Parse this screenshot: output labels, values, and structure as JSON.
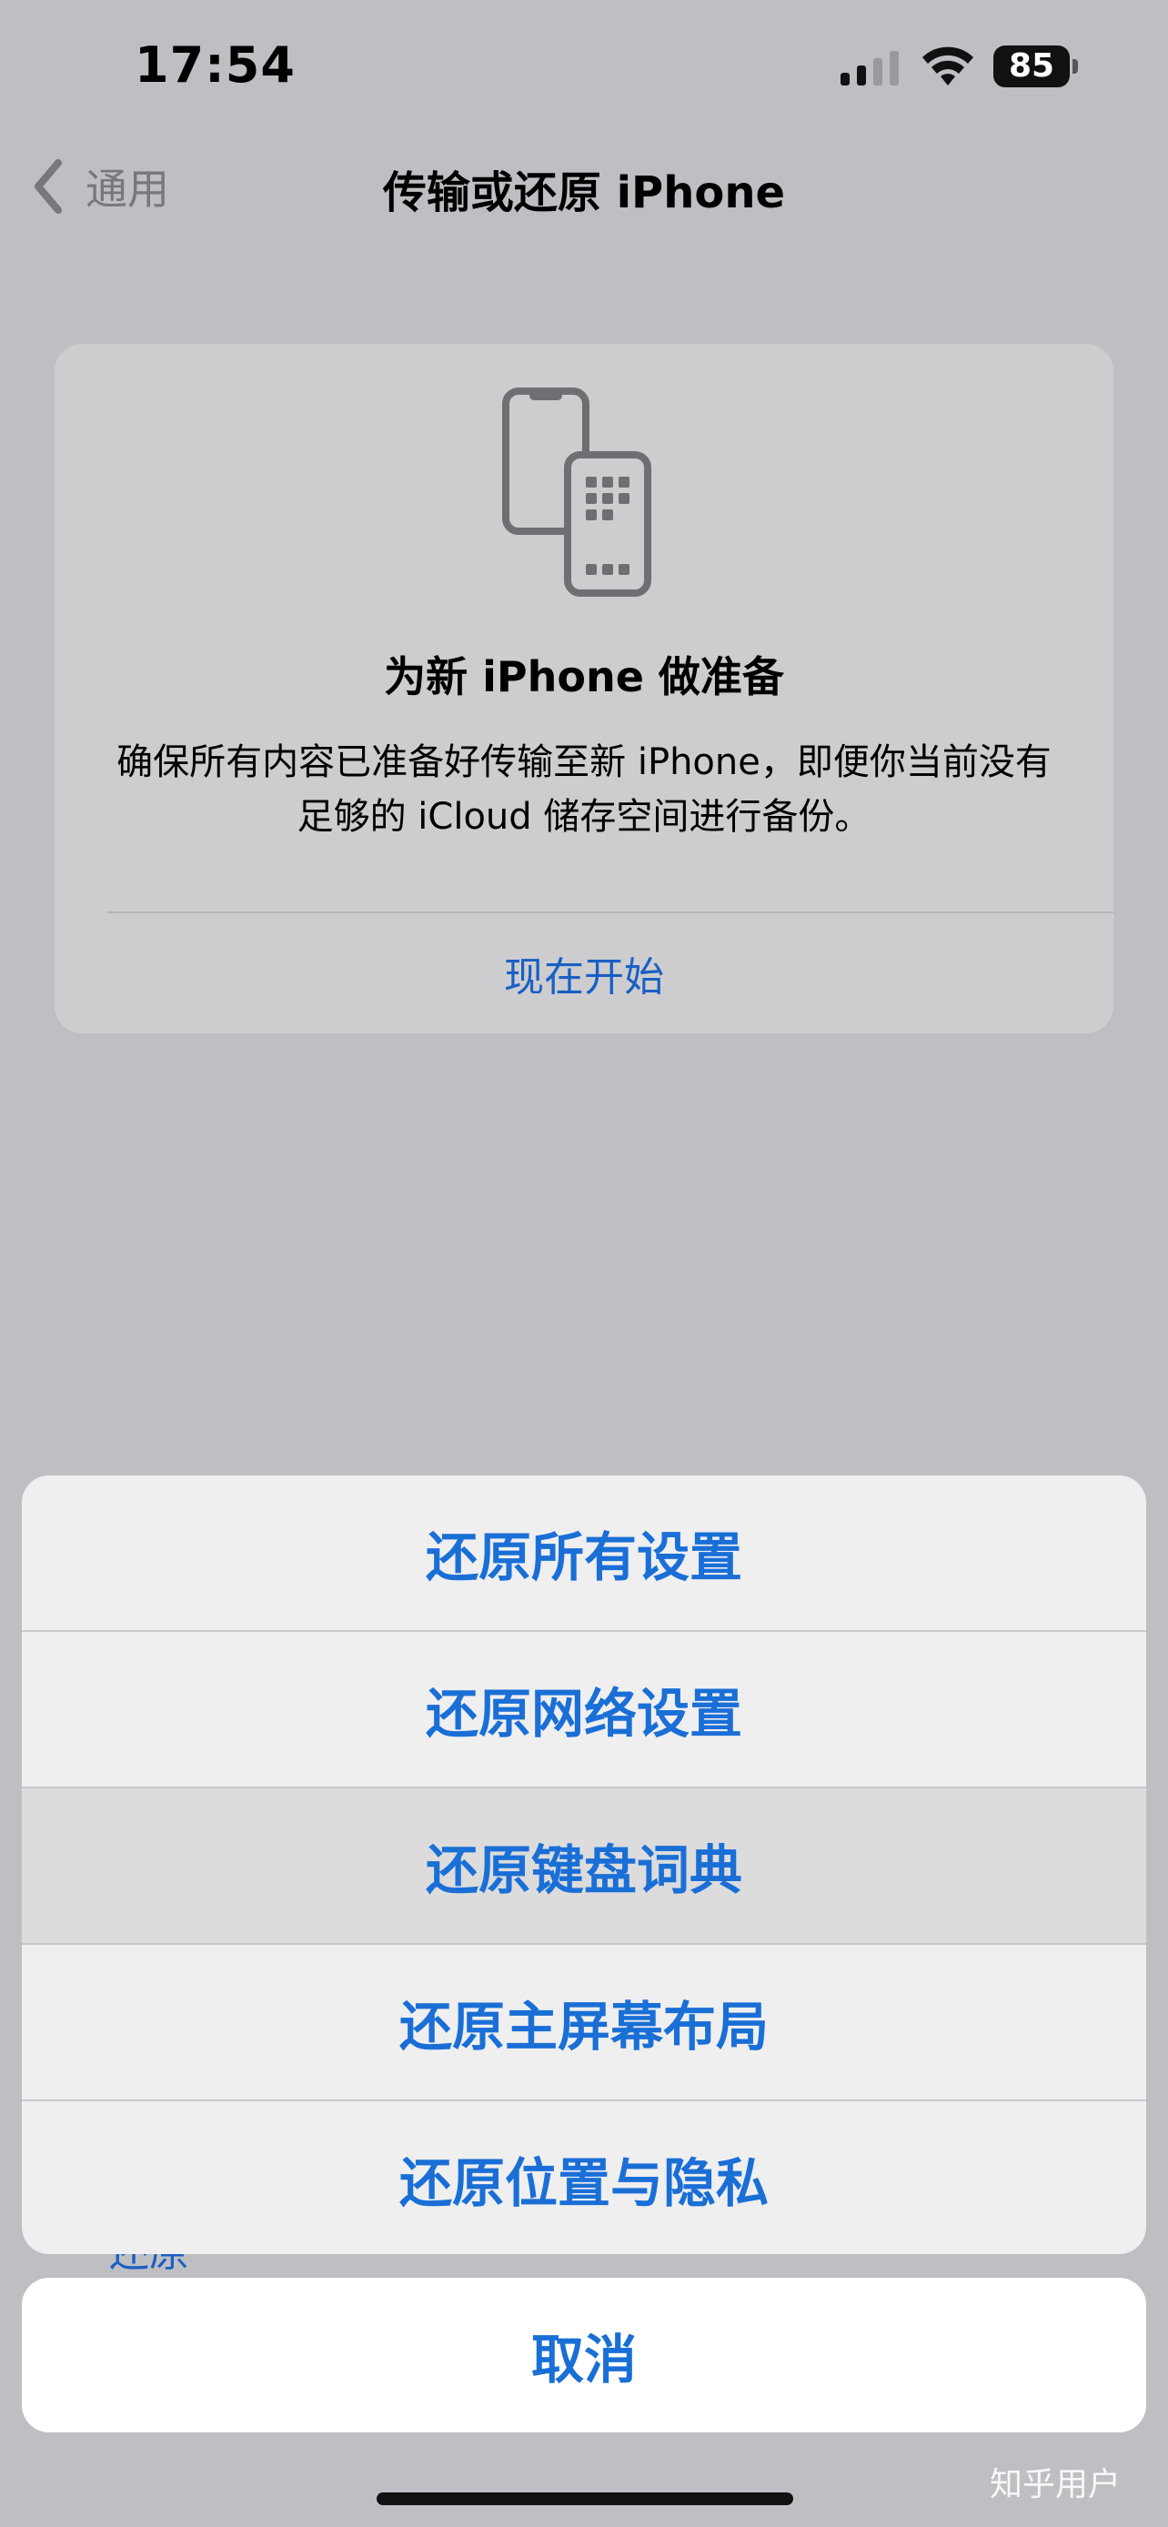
{
  "status_bar": {
    "time": "17:54",
    "battery": "85",
    "icons": [
      "cellular-signal-icon",
      "wifi-icon",
      "battery-icon"
    ]
  },
  "nav": {
    "back_label": "通用",
    "back_icon": "chevron-left-icon",
    "title": "传输或还原 iPhone"
  },
  "card": {
    "icon": "two-phones-transfer-icon",
    "title": "为新 iPhone 做准备",
    "description": "确保所有内容已准备好传输至新 iPhone，即便你当前没有足够的 iCloud 储存空间进行备份。",
    "action_label": "现在开始"
  },
  "peek_label": "还原",
  "action_sheet": {
    "items": [
      {
        "label": "还原所有设置"
      },
      {
        "label": "还原网络设置"
      },
      {
        "label": "还原键盘词典"
      },
      {
        "label": "还原主屏幕布局"
      },
      {
        "label": "还原位置与隐私"
      }
    ],
    "cancel_label": "取消"
  },
  "watermark": "知乎用户",
  "colors": {
    "accent": "#1a6fd6",
    "background": "#bfbfc3",
    "sheet_background": "#efeff0",
    "pressed_row": "#dcdcdd"
  }
}
